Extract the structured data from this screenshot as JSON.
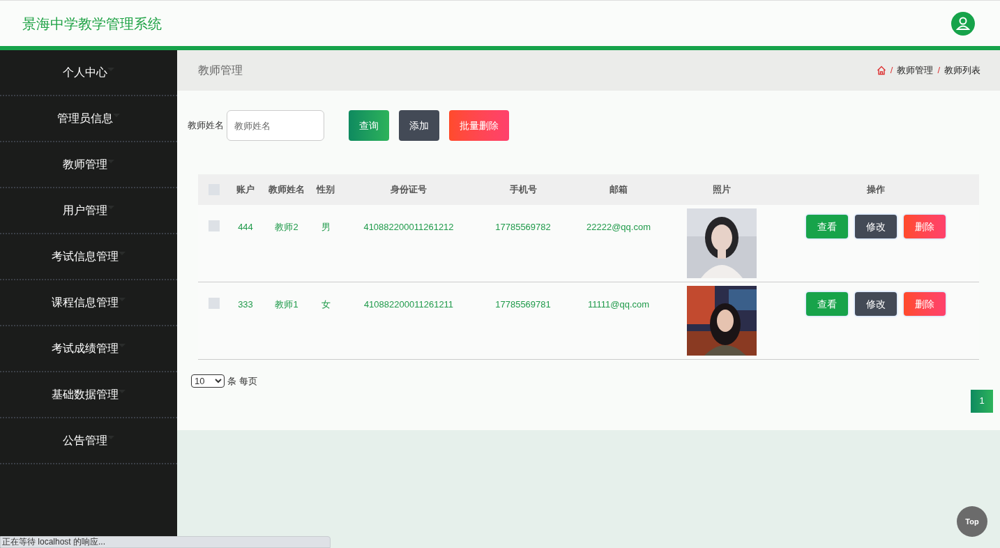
{
  "app_title": "景海中学教学管理系统",
  "sidebar": {
    "items": [
      {
        "label": "个人中心"
      },
      {
        "label": "管理员信息"
      },
      {
        "label": "教师管理"
      },
      {
        "label": "用户管理"
      },
      {
        "label": "考试信息管理"
      },
      {
        "label": "课程信息管理"
      },
      {
        "label": "考试成绩管理"
      },
      {
        "label": "基础数据管理"
      },
      {
        "label": "公告管理"
      }
    ]
  },
  "page_title": "教师管理",
  "breadcrumb": {
    "separator": "/",
    "items": [
      "教师管理",
      "教师列表"
    ]
  },
  "search": {
    "label": "教师姓名",
    "placeholder": "教师姓名"
  },
  "toolbar_buttons": [
    {
      "label": "查询",
      "kind": "query"
    },
    {
      "label": "添加",
      "kind": "add"
    },
    {
      "label": "批量删除",
      "kind": "delete"
    }
  ],
  "table": {
    "select_all_checked": false,
    "columns": [
      "账户",
      "教师姓名",
      "性别",
      "身份证号",
      "手机号",
      "邮箱",
      "照片",
      "操作"
    ],
    "rows": [
      {
        "checked": false,
        "cells": [
          "444",
          "教师2",
          "男",
          "410882200011261212",
          "17785569782",
          "22222@qq.com"
        ],
        "actions": [
          {
            "label": "查看",
            "kind": "view"
          },
          {
            "label": "修改",
            "kind": "edit"
          },
          {
            "label": "删除",
            "kind": "delete"
          }
        ]
      },
      {
        "checked": false,
        "cells": [
          "333",
          "教师1",
          "女",
          "410882200011261211",
          "17785569781",
          "11111@qq.com"
        ],
        "actions": [
          {
            "label": "查看",
            "kind": "view"
          },
          {
            "label": "修改",
            "kind": "edit"
          },
          {
            "label": "删除",
            "kind": "delete"
          }
        ]
      }
    ]
  },
  "page_size": {
    "value": "10",
    "label": "条 每页"
  },
  "pages": [
    {
      "label": "1",
      "selected": true
    }
  ],
  "top_button": "Top",
  "status_bar": "正在等待 localhost 的响应..."
}
